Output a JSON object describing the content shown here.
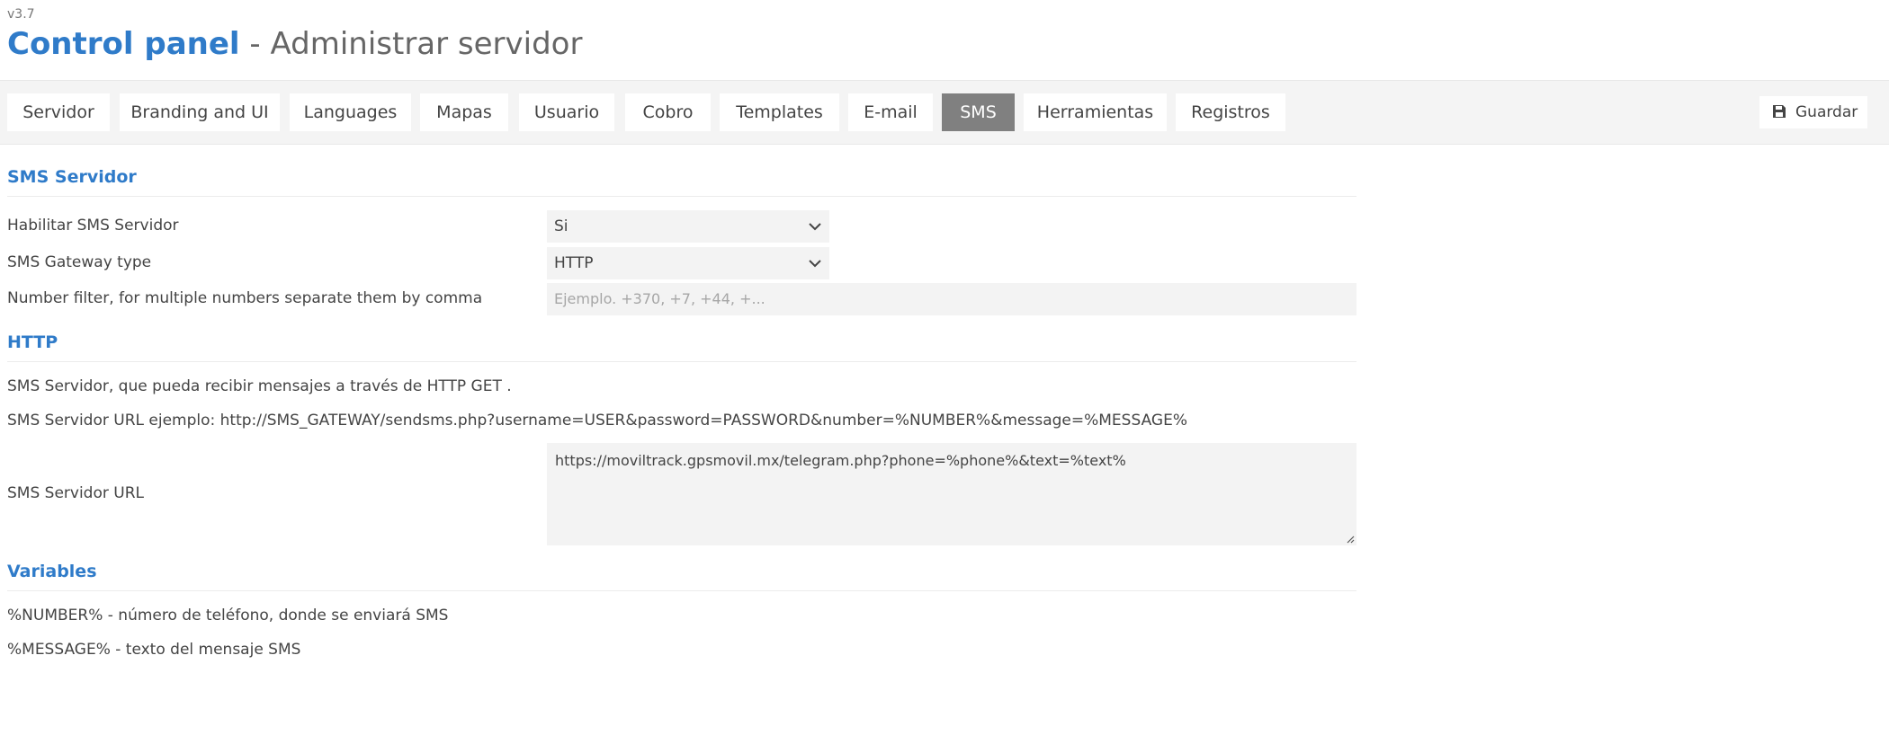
{
  "header": {
    "version": "v3.7",
    "title_brand": "Control panel",
    "title_sub": " - Administrar servidor"
  },
  "tabs": [
    {
      "label": "Servidor",
      "active": false
    },
    {
      "label": "Branding and UI",
      "active": false
    },
    {
      "label": "Languages",
      "active": false
    },
    {
      "label": "Mapas",
      "active": false
    },
    {
      "label": "Usuario",
      "active": false
    },
    {
      "label": "Cobro",
      "active": false
    },
    {
      "label": "Templates",
      "active": false
    },
    {
      "label": "E-mail",
      "active": false
    },
    {
      "label": "SMS",
      "active": true
    },
    {
      "label": "Herramientas",
      "active": false
    },
    {
      "label": "Registros",
      "active": false
    }
  ],
  "toolbar": {
    "save_label": "Guardar",
    "save_icon": "floppy-disk-icon"
  },
  "sms_server": {
    "section_title": "SMS Servidor",
    "enable_label": "Habilitar SMS Servidor",
    "enable_value": "Si",
    "gateway_label": "SMS Gateway type",
    "gateway_value": "HTTP",
    "filter_label": "Number filter, for multiple numbers separate them by comma",
    "filter_placeholder": "Ejemplo. +370, +7, +44, +...",
    "filter_value": ""
  },
  "http": {
    "section_title": "HTTP",
    "description": "SMS Servidor, que pueda recibir mensajes a través de HTTP GET .",
    "example": "SMS Servidor URL ejemplo: http://SMS_GATEWAY/sendsms.php?username=USER&password=PASSWORD&number=%NUMBER%&message=%MESSAGE%",
    "url_label": "SMS Servidor URL",
    "url_value": "https://moviltrack.gpsmovil.mx/telegram.php?phone=%phone%&text=%text%"
  },
  "variables": {
    "section_title": "Variables",
    "items": [
      "%NUMBER% - número de teléfono, donde se enviará SMS",
      "%MESSAGE% - texto del mensaje SMS"
    ]
  },
  "colors": {
    "accent": "#2f7bc9",
    "active_tab": "#808080",
    "field_bg": "#f3f3f3"
  }
}
